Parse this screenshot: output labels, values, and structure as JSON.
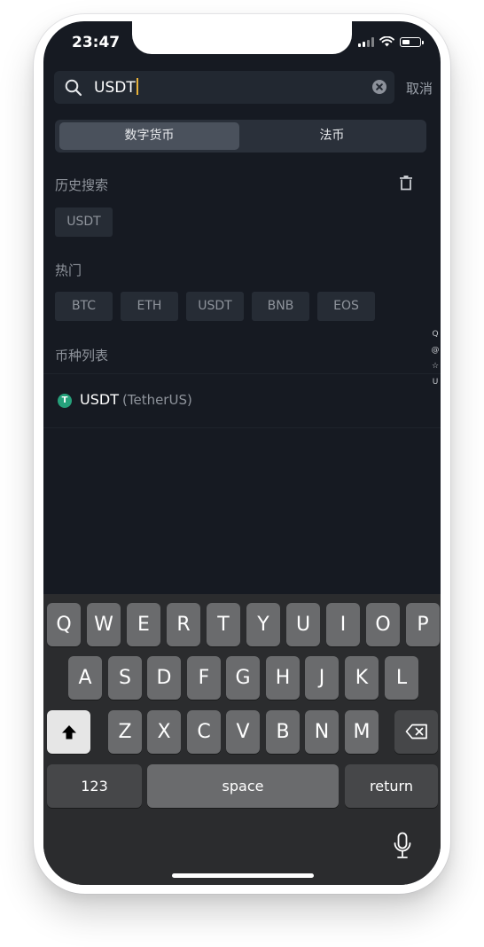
{
  "status_bar": {
    "time": "23:47"
  },
  "search": {
    "query": "USDT",
    "cancel_label": "取消"
  },
  "segments": [
    {
      "label": "数字货币",
      "active": true
    },
    {
      "label": "法币",
      "active": false
    }
  ],
  "history": {
    "title": "历史搜索",
    "items": [
      "USDT"
    ]
  },
  "hot": {
    "title": "热门",
    "items": [
      "BTC",
      "ETH",
      "USDT",
      "BNB",
      "EOS"
    ]
  },
  "coin_list": {
    "title": "币种列表",
    "items": [
      {
        "icon_letter": "T",
        "symbol": "USDT",
        "name": "(TetherUS)",
        "icon_color": "#26a17b"
      }
    ]
  },
  "index_bar": {
    "letters": [
      "Q",
      "@",
      "☆",
      "U"
    ]
  },
  "keyboard": {
    "row1": [
      "Q",
      "W",
      "E",
      "R",
      "T",
      "Y",
      "U",
      "I",
      "O",
      "P"
    ],
    "row2": [
      "A",
      "S",
      "D",
      "F",
      "G",
      "H",
      "J",
      "K",
      "L"
    ],
    "row3": [
      "Z",
      "X",
      "C",
      "V",
      "B",
      "N",
      "M"
    ],
    "numbers_label": "123",
    "space_label": "space",
    "return_label": "return"
  },
  "colors": {
    "accent_caret": "#e8b23a",
    "background": "#161a22",
    "tether_green": "#26a17b"
  }
}
